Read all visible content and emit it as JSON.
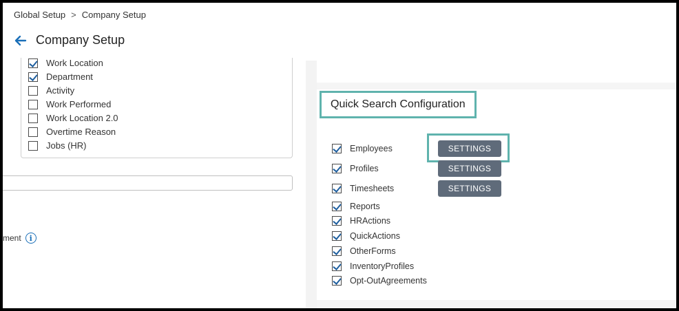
{
  "breadcrumb": {
    "items": [
      "Global Setup",
      "Company Setup"
    ],
    "separator": ">"
  },
  "header": {
    "title": "Company Setup"
  },
  "dimensions": {
    "items": [
      {
        "label": "Work Location",
        "checked": true
      },
      {
        "label": "Department",
        "checked": true
      },
      {
        "label": "Activity",
        "checked": false
      },
      {
        "label": "Work Performed",
        "checked": false
      },
      {
        "label": "Work Location 2.0",
        "checked": false
      },
      {
        "label": "Overtime Reason",
        "checked": false
      },
      {
        "label": "Jobs (HR)",
        "checked": false
      }
    ]
  },
  "left_field": {
    "value": ""
  },
  "partial_setting": {
    "label_fragment": "ment"
  },
  "quick_search": {
    "title": "Quick Search Configuration",
    "settings_label": "SETTINGS",
    "items": [
      {
        "label": "Employees",
        "checked": true,
        "has_settings": true
      },
      {
        "label": "Profiles",
        "checked": true,
        "has_settings": true
      },
      {
        "label": "Timesheets",
        "checked": true,
        "has_settings": true
      },
      {
        "label": "Reports",
        "checked": true,
        "has_settings": false
      },
      {
        "label": "HRActions",
        "checked": true,
        "has_settings": false
      },
      {
        "label": "QuickActions",
        "checked": true,
        "has_settings": false
      },
      {
        "label": "OtherForms",
        "checked": true,
        "has_settings": false
      },
      {
        "label": "InventoryProfiles",
        "checked": true,
        "has_settings": false
      },
      {
        "label": "Opt-OutAgreements",
        "checked": true,
        "has_settings": false
      }
    ]
  },
  "colors": {
    "highlight": "#5fb3ad",
    "button": "#5f6b7a",
    "accent": "#1a6fb8"
  },
  "icons": {
    "back": "arrow-left-icon",
    "info": "info-icon",
    "check": "checkmark-icon"
  }
}
